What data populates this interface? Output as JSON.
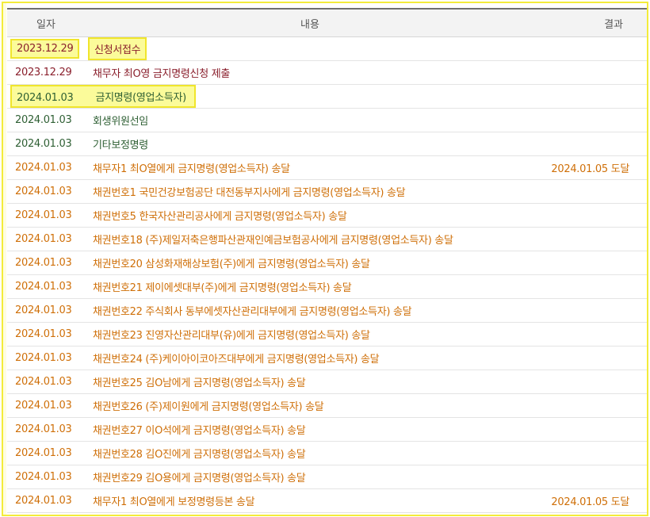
{
  "headers": {
    "date": "일자",
    "content": "내용",
    "result": "결과"
  },
  "rows": [
    {
      "date": "2023.12.29",
      "content": "신청서접수",
      "result": ""
    },
    {
      "date": "2023.12.29",
      "content": "채무자 최O영 금지명령신청 제출",
      "result": ""
    },
    {
      "date": "2024.01.03",
      "content": "금지명령(영업소득자)",
      "result": ""
    },
    {
      "date": "2024.01.03",
      "content": "회생위원선임",
      "result": ""
    },
    {
      "date": "2024.01.03",
      "content": "기타보정명령",
      "result": ""
    },
    {
      "date": "2024.01.03",
      "content": "채무자1 최O열에게 금지명령(영업소득자) 송달",
      "result": "2024.01.05 도달"
    },
    {
      "date": "2024.01.03",
      "content": "채권번호1 국민건강보험공단 대전동부지사에게 금지명령(영업소득자) 송달",
      "result": ""
    },
    {
      "date": "2024.01.03",
      "content": "채권번호5 한국자산관리공사에게 금지명령(영업소득자) 송달",
      "result": ""
    },
    {
      "date": "2024.01.03",
      "content": "채권번호18 (주)제일저축은행파산관재인예금보험공사에게 금지명령(영업소득자) 송달",
      "result": ""
    },
    {
      "date": "2024.01.03",
      "content": "채권번호20 삼성화재해상보험(주)에게 금지명령(영업소득자) 송달",
      "result": ""
    },
    {
      "date": "2024.01.03",
      "content": "채권번호21 제이에셋대부(주)에게 금지명령(영업소득자) 송달",
      "result": ""
    },
    {
      "date": "2024.01.03",
      "content": "채권번호22 주식회사 동부에셋자산관리대부에게 금지명령(영업소득자) 송달",
      "result": ""
    },
    {
      "date": "2024.01.03",
      "content": "채권번호23 진영자산관리대부(유)에게 금지명령(영업소득자) 송달",
      "result": ""
    },
    {
      "date": "2024.01.03",
      "content": "채권번호24 (주)케이아이코아즈대부에게 금지명령(영업소득자) 송달",
      "result": ""
    },
    {
      "date": "2024.01.03",
      "content": "채권번호25 김O남에게 금지명령(영업소득자) 송달",
      "result": ""
    },
    {
      "date": "2024.01.03",
      "content": "채권번호26 (주)제이원에게 금지명령(영업소득자) 송달",
      "result": ""
    },
    {
      "date": "2024.01.03",
      "content": "채권번호27 이O석에게 금지명령(영업소득자) 송달",
      "result": ""
    },
    {
      "date": "2024.01.03",
      "content": "채권번호28 김O진에게 금지명령(영업소득자) 송달",
      "result": ""
    },
    {
      "date": "2024.01.03",
      "content": "채권번호29 김O용에게 금지명령(영업소득자) 송달",
      "result": ""
    },
    {
      "date": "2024.01.03",
      "content": "채무자1 최O열에게 보정명령등본 송달",
      "result": "2024.01.05 도달"
    }
  ],
  "colors": {
    "maroon": "#8a1f2c",
    "green": "#2e5f33",
    "orange": "#cf6f08",
    "highlight": "#fbfb9a",
    "frame": "#f3ec3a"
  }
}
